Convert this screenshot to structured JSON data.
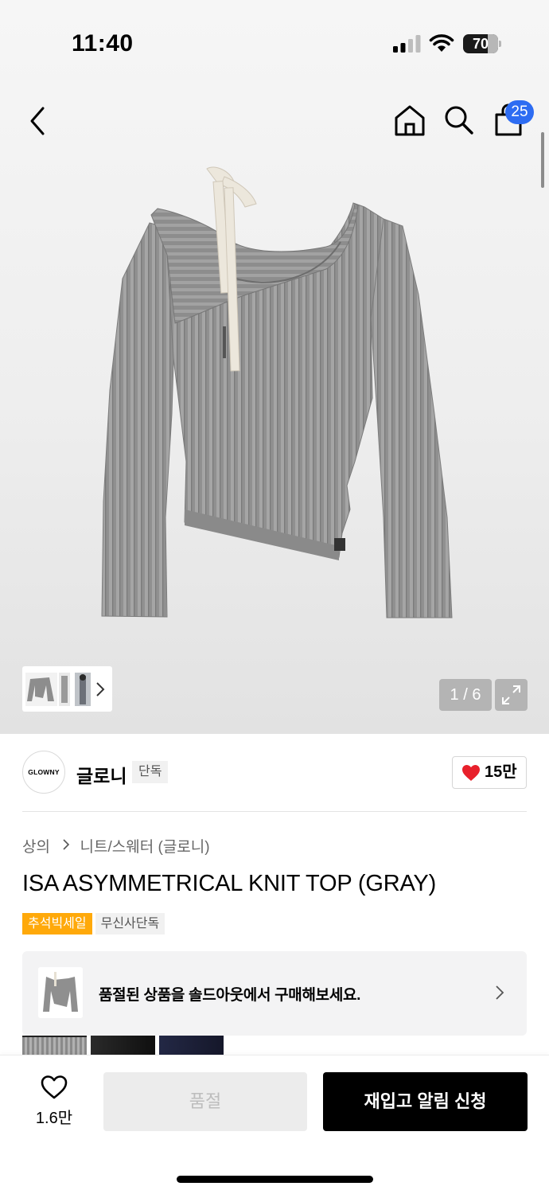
{
  "status_bar": {
    "time": "11:40",
    "battery": "70",
    "battery_level_percent": 70
  },
  "nav": {
    "back_icon": "chevron-left-icon",
    "home_icon": "home-icon",
    "search_icon": "search-icon",
    "cart_icon": "shopping-bag-icon",
    "cart_count": "25",
    "badge_color": "#2d6cf2"
  },
  "gallery": {
    "page_counter": "1 / 6",
    "expand_icon": "expand-icon",
    "thumbnails_chevron_icon": "chevron-right-icon"
  },
  "brand": {
    "logo_text": "GLOWNY",
    "name": "글로니",
    "tag": "단독",
    "like_icon": "heart-filled-icon",
    "like_count": "15만",
    "like_color": "#e8202b"
  },
  "product": {
    "breadcrumb": [
      "상의",
      "니트/스웨터 (글로니)"
    ],
    "title": "ISA ASYMMETRICAL KNIT TOP (GRAY)",
    "tags": [
      {
        "label": "추석빅세일",
        "color": "#ffa90a"
      },
      {
        "label": "무신사단독",
        "color": "#f1f1f1"
      }
    ]
  },
  "soldout_banner": {
    "text": "품절된 상품을 솔드아웃에서 구매해보세요.",
    "chevron_icon": "chevron-right-icon"
  },
  "bottom_bar": {
    "wish_icon": "heart-outline-icon",
    "wish_count": "1.6만",
    "soldout_label": "품절",
    "restock_label": "재입고 알림 신청"
  }
}
